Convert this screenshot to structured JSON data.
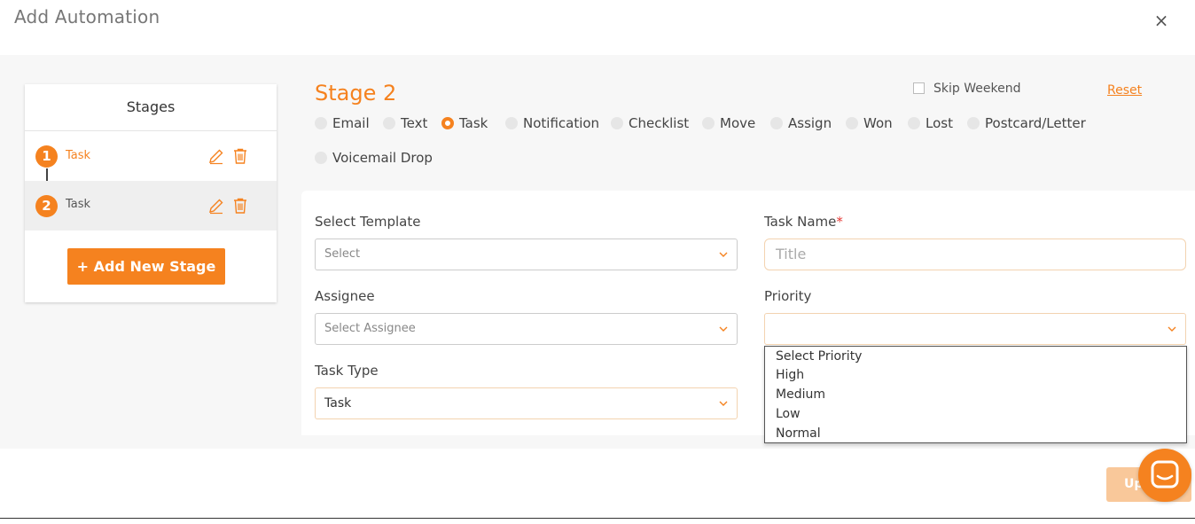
{
  "modal": {
    "title": "Add Automation",
    "close": "×"
  },
  "stages": {
    "header": "Stages",
    "items": [
      {
        "number": "1",
        "label": "Task"
      },
      {
        "number": "2",
        "label": "Task"
      }
    ],
    "add_label": "+ Add New Stage"
  },
  "editor": {
    "stage_title": "Stage 2",
    "skip_weekend": "Skip Weekend",
    "reset": "Reset",
    "types": [
      "Email",
      "Text",
      "Task",
      "Notification",
      "Checklist",
      "Move",
      "Assign",
      "Won",
      "Lost",
      "Postcard/Letter",
      "Voicemail Drop"
    ],
    "selected_type": "Task"
  },
  "form": {
    "template_label": "Select Template",
    "template_value": "Select",
    "task_name_label": "Task Name",
    "task_name_required": "*",
    "task_name_placeholder": "Title",
    "assignee_label": "Assignee",
    "assignee_value": "Select Assignee",
    "priority_label": "Priority",
    "priority_value": "",
    "priority_options": [
      "Select Priority",
      "High",
      "Medium",
      "Low",
      "Normal"
    ],
    "task_type_label": "Task Type",
    "task_type_value": "Task"
  },
  "footer": {
    "update_label": "Up"
  },
  "colors": {
    "accent": "#f5821f",
    "accent_light": "#f9c89a"
  }
}
